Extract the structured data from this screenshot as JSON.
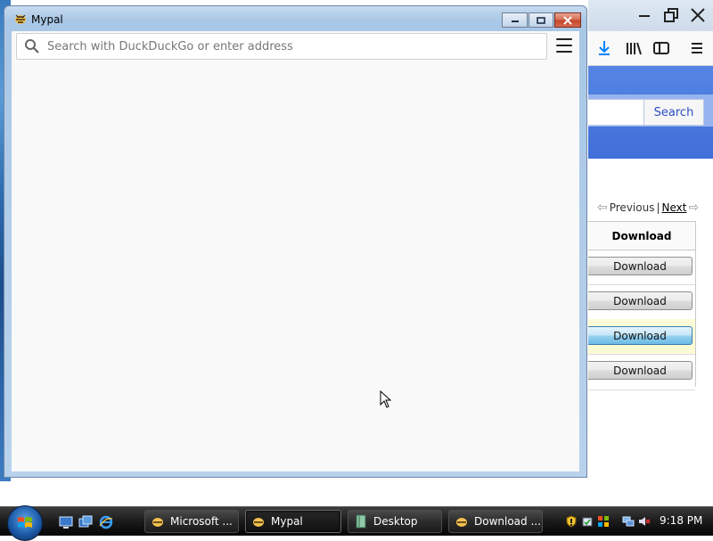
{
  "background_browser": {
    "search_button_label": "Search",
    "pager": {
      "prev_label": "Previous",
      "separator": "|",
      "next_label": "Next"
    },
    "table_header": "Download",
    "download_buttons": [
      "Download",
      "Download",
      "Download",
      "Download"
    ]
  },
  "window": {
    "title": "Mypal",
    "urlbar_placeholder": "Search with DuckDuckGo or enter address"
  },
  "taskbar": {
    "tasks": [
      {
        "label": "Microsoft ..."
      },
      {
        "label": "Mypal"
      },
      {
        "label": "Desktop"
      },
      {
        "label": "Download ..."
      }
    ],
    "clock": "9:18 PM"
  },
  "colors": {
    "banner_blue": "#4f7fe0",
    "taskbar_dark": "#1d1d1d",
    "window_frame": "#b8d2ec",
    "active_download_button": "#98d1ef",
    "highlight_row": "#fdfbd6"
  }
}
